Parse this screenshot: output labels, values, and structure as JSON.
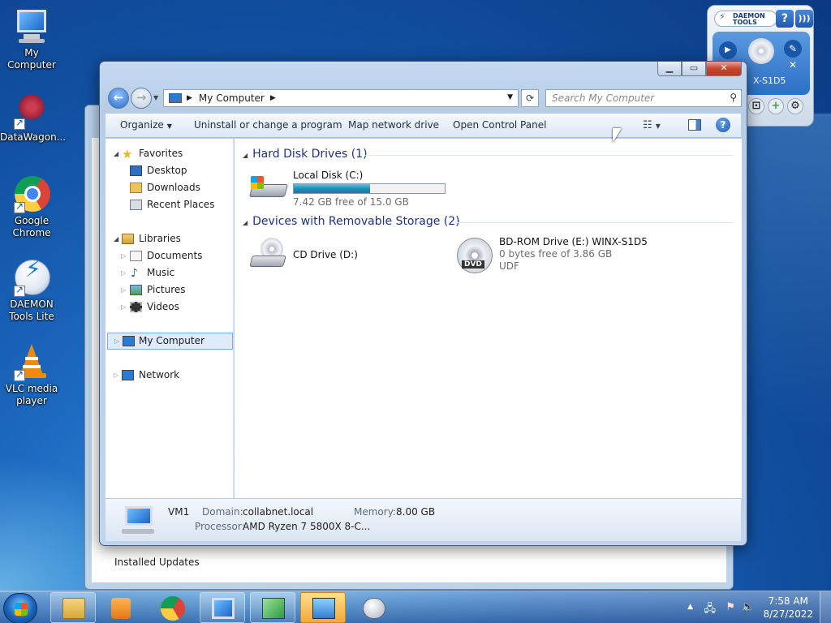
{
  "desktop": {
    "icons": [
      {
        "label": "My Computer",
        "icon": "computer-icon"
      },
      {
        "label": "DataWagon...",
        "icon": "datawagon-icon"
      },
      {
        "label": "Google Chrome",
        "icon": "chrome-icon"
      },
      {
        "label": "DAEMON Tools Lite",
        "icon": "daemon-tools-icon"
      },
      {
        "label": "VLC media player",
        "icon": "vlc-icon"
      }
    ]
  },
  "daemon_gadget": {
    "brand": "DAEMON TOOLS",
    "help": "?",
    "drive_name": "X-S1D5"
  },
  "background_window": {
    "item": "Installed Updates"
  },
  "explorer": {
    "address": "My Computer",
    "search_placeholder": "Search My Computer",
    "commands": {
      "organize": "Organize",
      "uninstall": "Uninstall or change a program",
      "map_drive": "Map network drive",
      "control_panel": "Open Control Panel",
      "help": "?"
    },
    "nav": {
      "favorites": "Favorites",
      "desktop": "Desktop",
      "downloads": "Downloads",
      "recent": "Recent Places",
      "libraries": "Libraries",
      "documents": "Documents",
      "music": "Music",
      "pictures": "Pictures",
      "videos": "Videos",
      "my_computer": "My Computer",
      "network": "Network"
    },
    "groups": {
      "hdd": "Hard Disk Drives (1)",
      "removable": "Devices with Removable Storage (2)"
    },
    "drives": {
      "c": {
        "name": "Local Disk (C:)",
        "free": "7.42 GB free of 15.0 GB",
        "used_fraction": 0.505
      },
      "d": {
        "name": "CD Drive (D:)"
      },
      "e": {
        "name": "BD-ROM Drive (E:) WINX-S1D5",
        "free": "0 bytes free of 3.86 GB",
        "fs": "UDF",
        "badge": "DVD"
      }
    },
    "details": {
      "computer_name": "VM1",
      "domain_label": "Domain:",
      "domain": "collabnet.local",
      "memory_label": "Memory:",
      "memory": "8.00 GB",
      "processor_label": "Processor:",
      "processor": "AMD Ryzen 7 5800X 8-C..."
    }
  },
  "taskbar": {
    "time": "7:58 AM",
    "date": "8/27/2022"
  }
}
